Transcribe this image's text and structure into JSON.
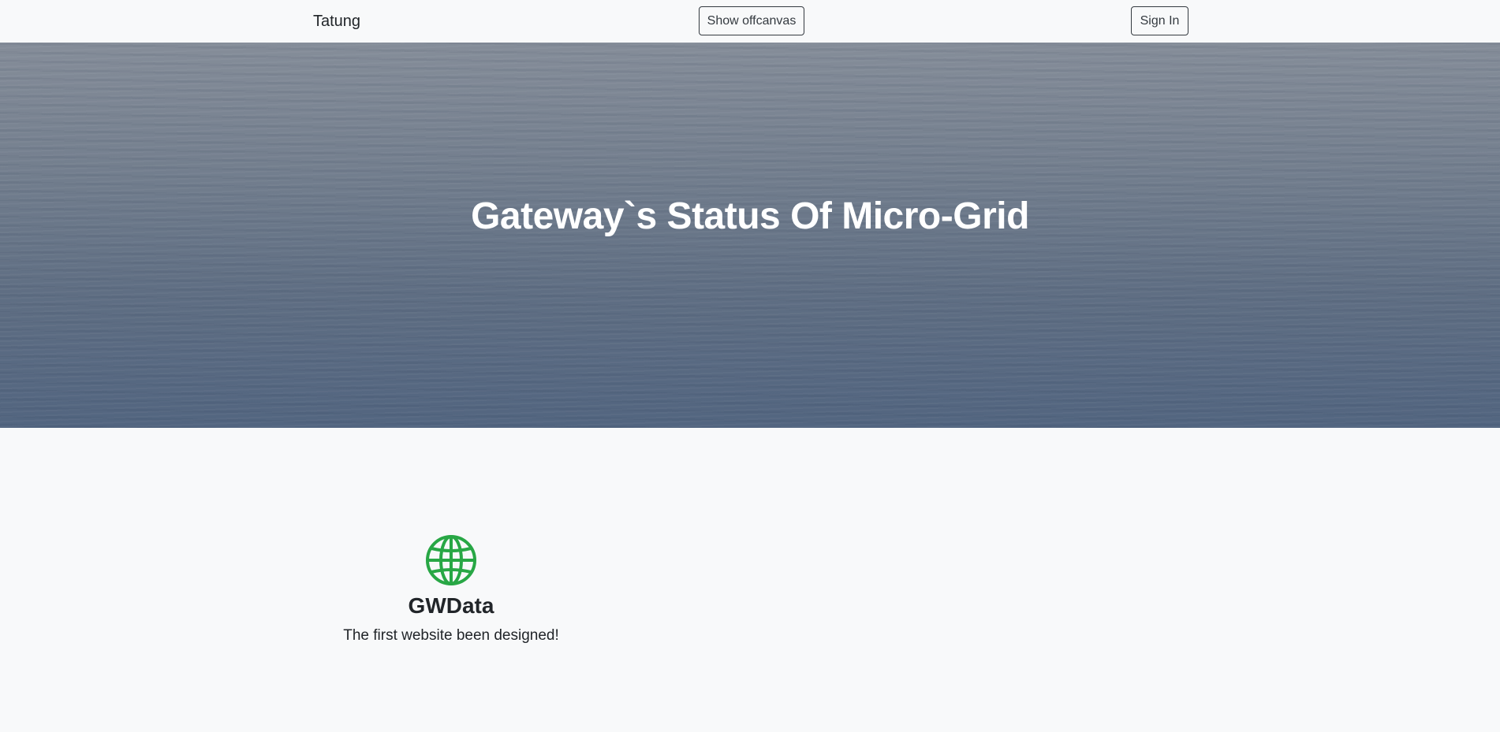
{
  "navbar": {
    "brand": "Tatung",
    "offcanvas_button": "Show offcanvas",
    "signin_button": "Sign In"
  },
  "hero": {
    "title": "Gateway`s Status Of Micro-Grid"
  },
  "features": {
    "items": [
      {
        "icon": "globe-icon",
        "title": "GWData",
        "text": "The first website been designed!"
      }
    ]
  },
  "colors": {
    "icon_green": "#28a745",
    "text_dark": "#212529",
    "background": "#f8f9fa"
  }
}
